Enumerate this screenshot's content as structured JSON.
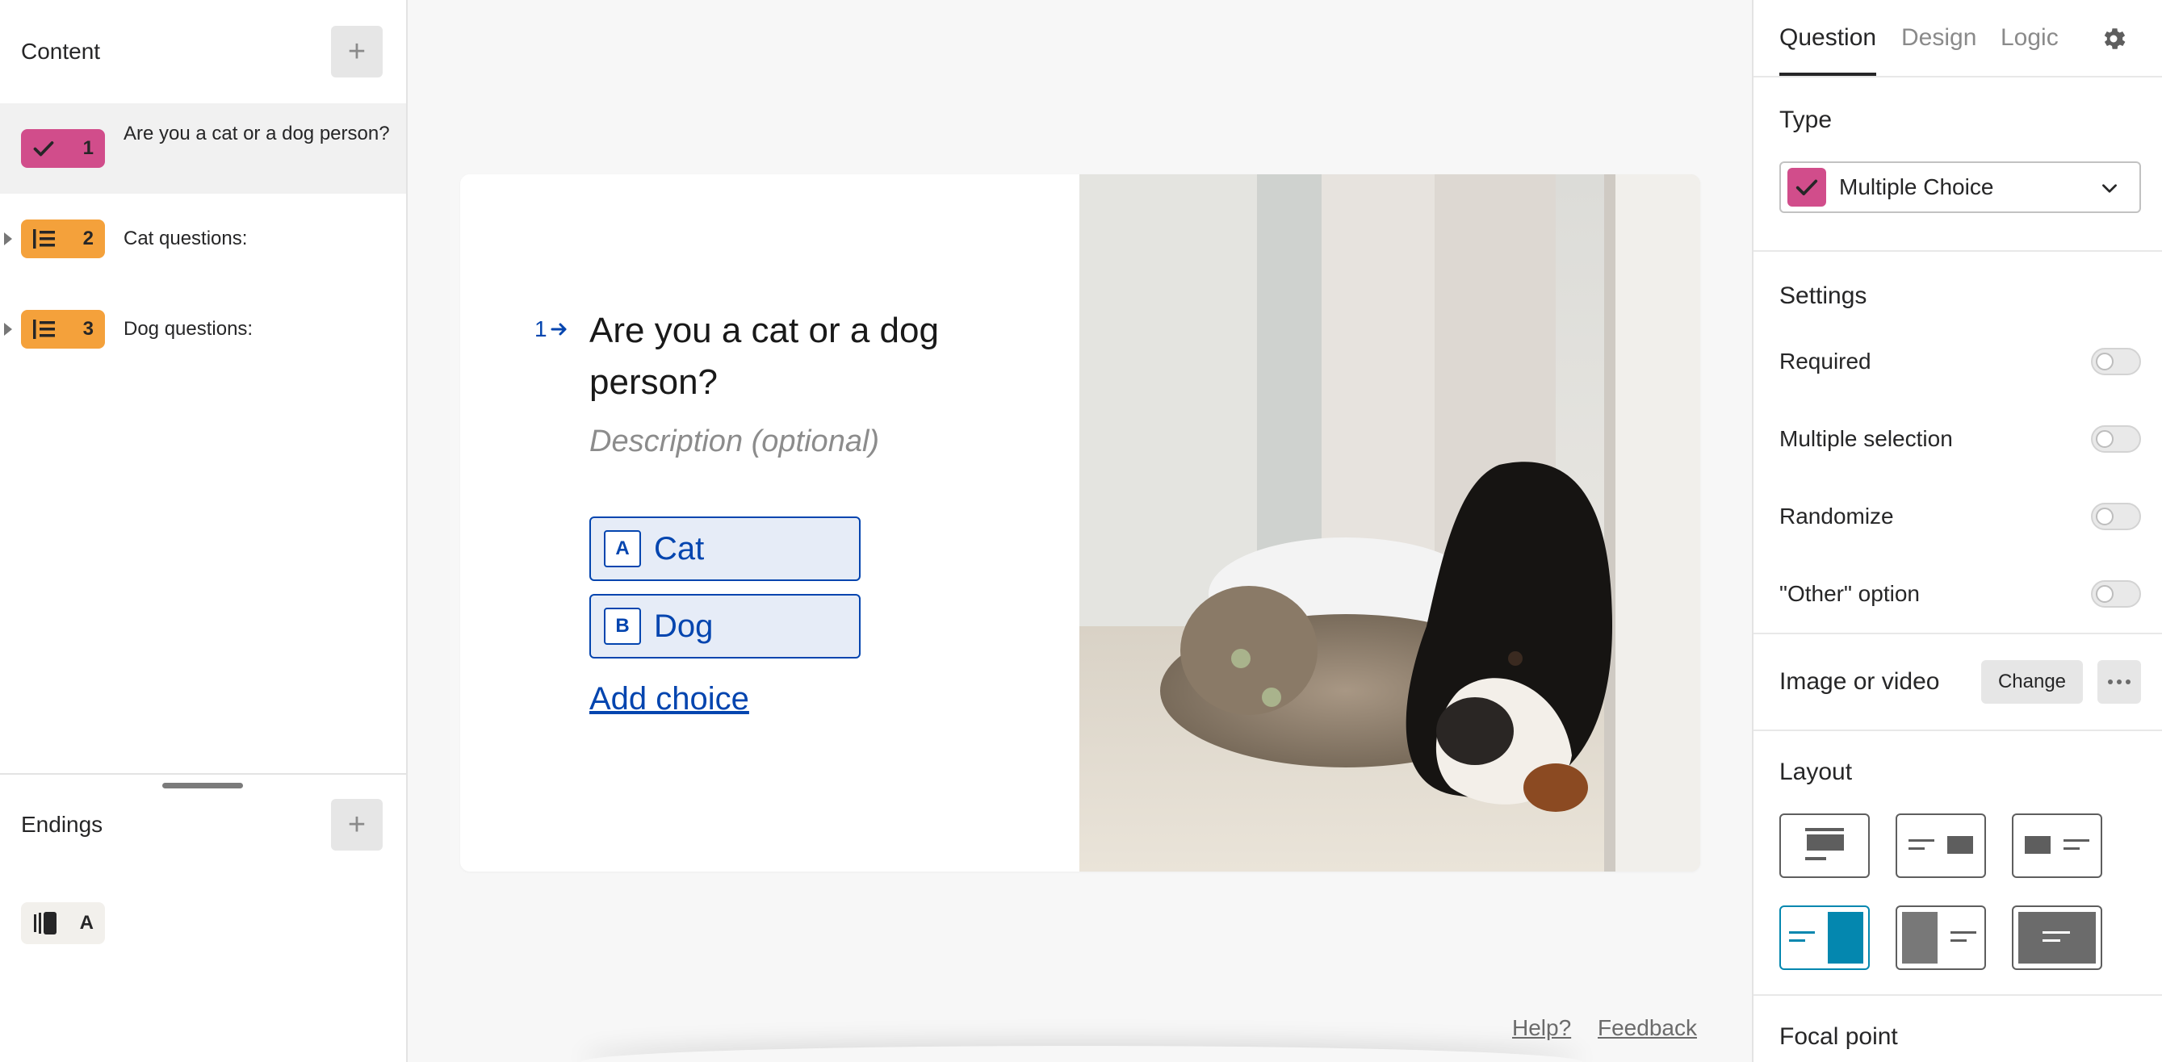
{
  "sidebar": {
    "content_title": "Content",
    "add_label": "+",
    "questions": [
      {
        "number": "1",
        "text": "Are you a cat or a dog person?",
        "type_icon": "check-icon",
        "color": "#D14D8B",
        "selected": true
      },
      {
        "number": "2",
        "text": "Cat questions:",
        "type_icon": "question-group-icon",
        "color": "#F4A13B"
      },
      {
        "number": "3",
        "text": "Dog questions:",
        "type_icon": "question-group-icon",
        "color": "#F4A13B"
      }
    ],
    "endings_title": "Endings",
    "endings": [
      {
        "letter": "A",
        "type_icon": "ending-screen-icon"
      }
    ]
  },
  "canvas": {
    "question_number": "1",
    "question_title": "Are you a cat or a dog person?",
    "description_placeholder": "Description (optional)",
    "choices": [
      {
        "key": "A",
        "label": "Cat"
      },
      {
        "key": "B",
        "label": "Dog"
      }
    ],
    "add_choice": "Add choice",
    "accent": "#0445AF",
    "footer": {
      "help": "Help?",
      "feedback": "Feedback"
    }
  },
  "panel": {
    "tabs": [
      "Question",
      "Design",
      "Logic"
    ],
    "active_tab": "Question",
    "type_title": "Type",
    "type_value": "Multiple Choice",
    "settings_title": "Settings",
    "settings": [
      {
        "label": "Required",
        "on": false
      },
      {
        "label": "Multiple selection",
        "on": false
      },
      {
        "label": "Randomize",
        "on": false
      },
      {
        "label": "\"Other\" option",
        "on": false
      }
    ],
    "media_title": "Image or video",
    "change_label": "Change",
    "layout_title": "Layout",
    "layout_active_index": 3,
    "layout_accent": "#0487AF",
    "focal_title": "Focal point"
  }
}
